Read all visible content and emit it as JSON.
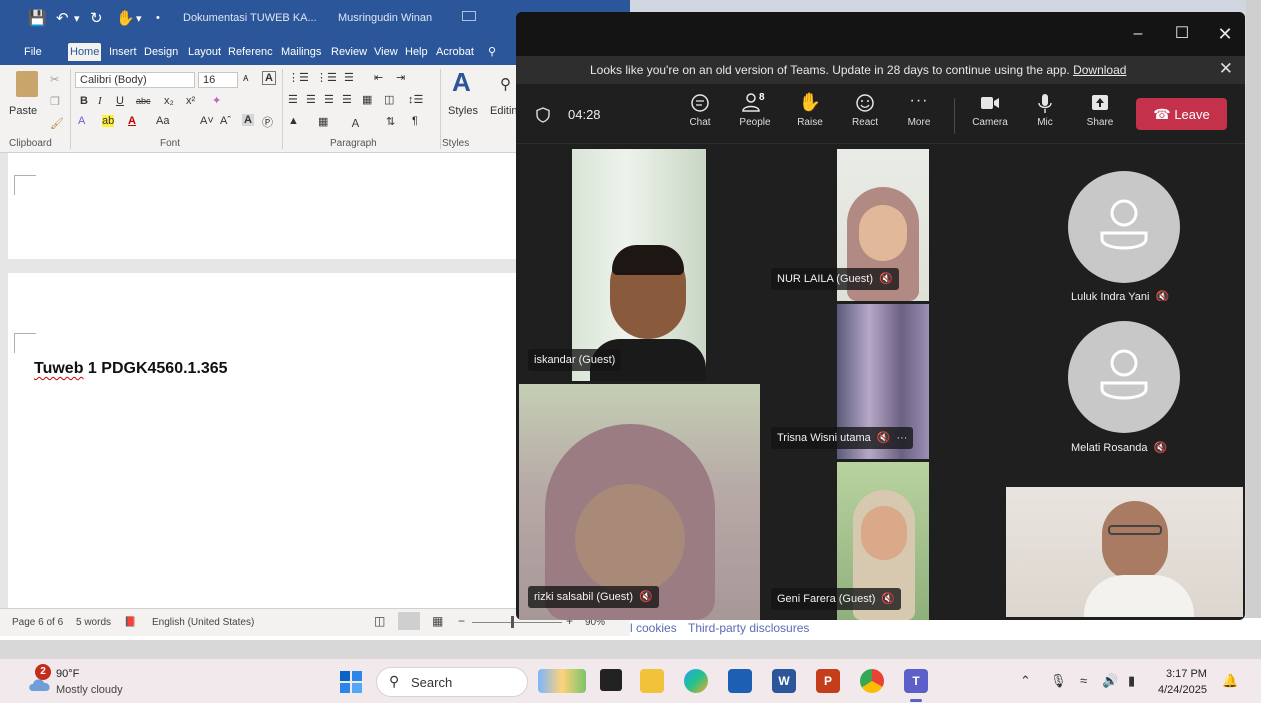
{
  "word": {
    "doc_title": "Dokumentasi TUWEB KA...",
    "user_name": "Musringudin Winan",
    "tabs": [
      "File",
      "Home",
      "Insert",
      "Design",
      "Layout",
      "Referenc",
      "Mailings",
      "Review",
      "View",
      "Help",
      "Acrobat"
    ],
    "active_tab": "Home",
    "ribbon": {
      "paste_label": "Paste",
      "font_name": "Calibri (Body)",
      "font_size": "16",
      "styles_label": "Styles",
      "editing_label": "Editin",
      "clipboard_label": "Clipboard",
      "font_label": "Font",
      "paragraph_label": "Paragraph",
      "styles_group_label": "Styles"
    },
    "document": {
      "heading_word": "Tuweb",
      "heading_rest": " 1 PDGK4560.1.365"
    },
    "status": {
      "page": "Page 6 of 6",
      "words": "5 words",
      "language": "English (United States)",
      "zoom": "90%"
    }
  },
  "browser": {
    "cookies_link": "l cookies",
    "third_party_link": "Third-party disclosures"
  },
  "teams": {
    "banner": {
      "message": "Looks like you're on an old version of Teams. Update in 28 days to continue using the app.",
      "link": "Download"
    },
    "timer": "04:28",
    "people_count": "8",
    "buttons": {
      "chat": "Chat",
      "people": "People",
      "raise": "Raise",
      "react": "React",
      "more": "More",
      "camera": "Camera",
      "mic": "Mic",
      "share": "Share",
      "leave": "Leave"
    },
    "participants": {
      "iskandar": "iskandar (Guest)",
      "nur_laila": "NUR LAILA (Guest)",
      "luluk": "Luluk Indra Yani",
      "trisna": "Trisna Wisni utama",
      "melati": "Melati Rosanda",
      "rizki": "rizki salsabil (Guest)",
      "geni": "Geni Farera (Guest)"
    }
  },
  "taskbar": {
    "weather_badge": "2",
    "temperature": "90°F",
    "weather_desc": "Mostly cloudy",
    "search_label": "Search",
    "time": "3:17 PM",
    "date": "4/24/2025"
  },
  "colors": {
    "word_blue": "#2b579a",
    "teams_leave_red": "#c4314b",
    "teams_bg": "#1f1f1f"
  }
}
